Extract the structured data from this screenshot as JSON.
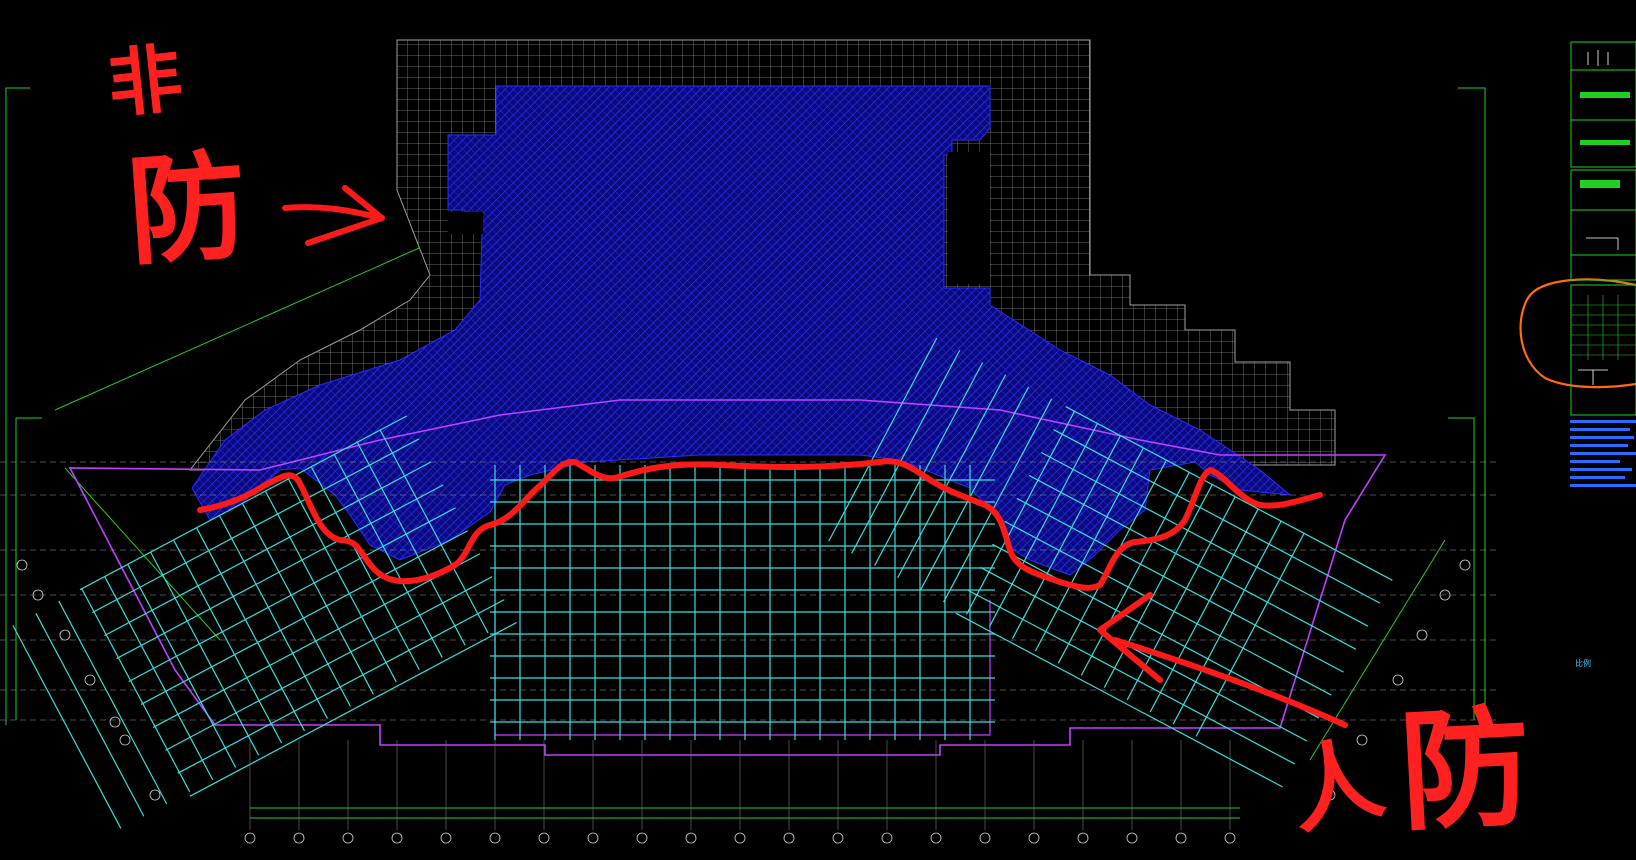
{
  "annotations": {
    "top_left_char1": "非",
    "top_left_char2": "防",
    "bottom_right_char1": "人",
    "bottom_right_char2": "防"
  },
  "colors": {
    "background": "#000000",
    "annotation_red": "#ff2020",
    "blue_hatch": "#1a1ab0",
    "grey_hatch": "#8a8a8a",
    "cyan_grid": "#34e0e0",
    "magenta_outline": "#c040ff",
    "green_frame": "#20d020",
    "orange_circle": "#ff6a10",
    "legend_blue": "#2a6cff"
  },
  "legend": {
    "scale_note": "比例"
  },
  "icons": {
    "arrow_left": "hand-drawn-arrow-icon",
    "arrow_right": "hand-drawn-arrow-icon",
    "highlight_circle": "hand-drawn-circle-icon"
  }
}
